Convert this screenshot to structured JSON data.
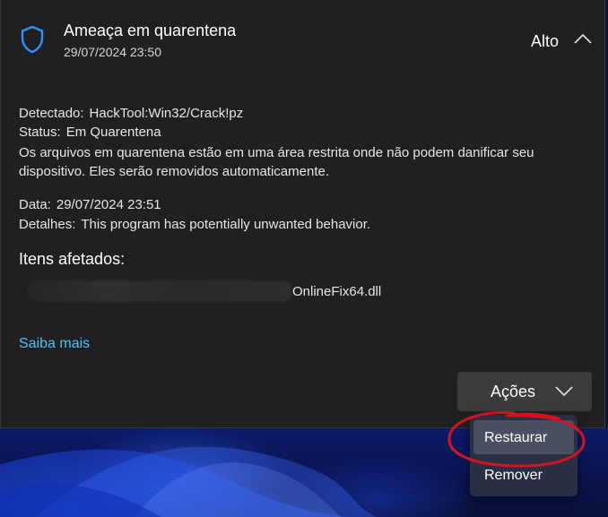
{
  "threat": {
    "title": "Ameaça em quarentena",
    "timestamp": "29/07/2024 23:50",
    "severity": "Alto",
    "detected_label": "Detectado:",
    "detected_value": "HackTool:Win32/Crack!pz",
    "status_label": "Status:",
    "status_value": "Em Quarentena",
    "description": "Os arquivos em quarentena estão em uma área restrita onde não podem danificar seu dispositivo. Eles serão removidos automaticamente.",
    "date_label": "Data:",
    "date_value": "29/07/2024 23:51",
    "details_label": "Detalhes:",
    "details_value": "This program has potentially unwanted behavior."
  },
  "affected": {
    "title": "Itens afetados:",
    "file": "OnlineFix64.dll"
  },
  "learn_more": "Saiba mais",
  "actions": {
    "label": "Ações",
    "menu": [
      "Restaurar",
      "Remover"
    ]
  },
  "colors": {
    "accent": "#4cc2ff",
    "shield": "#2f8fff",
    "panel": "#202020",
    "highlight_ink": "#d2141e"
  },
  "icons": [
    "shield-icon",
    "chevron-up-icon",
    "chevron-down-icon"
  ]
}
